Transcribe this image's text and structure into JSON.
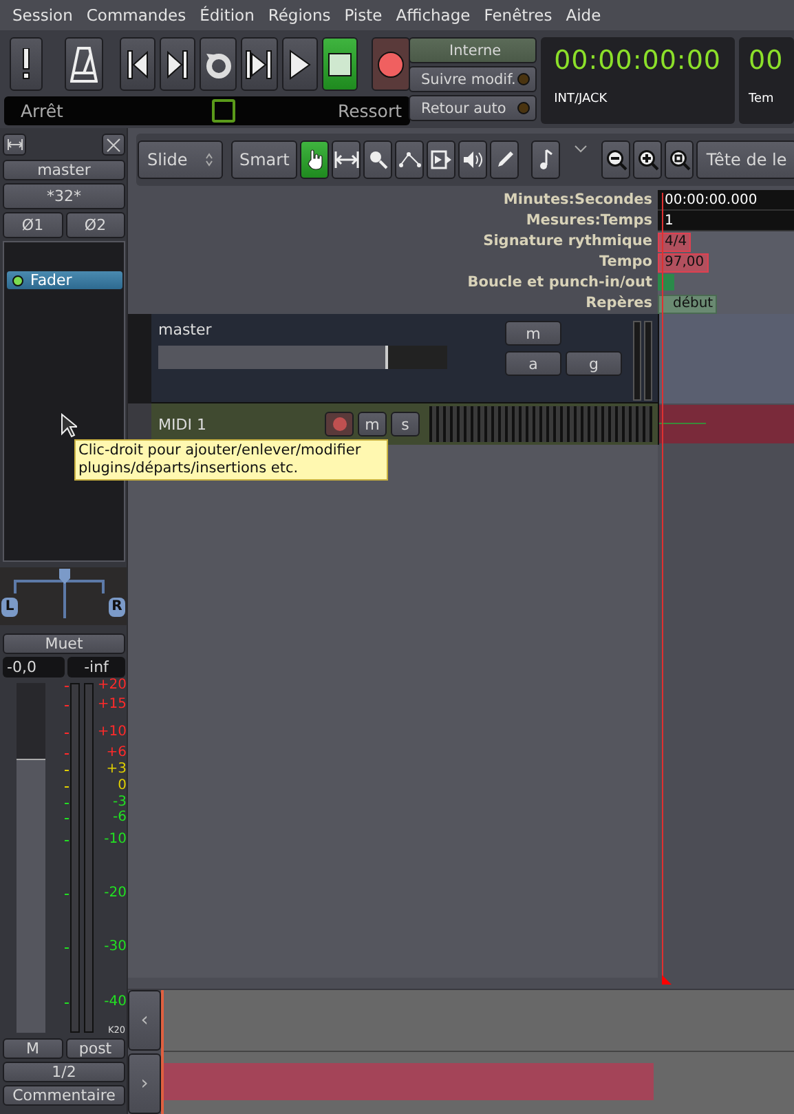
{
  "menu": [
    "Session",
    "Commandes",
    "Édition",
    "Régions",
    "Piste",
    "Affichage",
    "Fenêtres",
    "Aide"
  ],
  "transport": {
    "buttons": [
      {
        "kind": "alert",
        "on": false
      },
      {
        "kind": "metronome",
        "on": false
      },
      {
        "kind": "start",
        "on": false
      },
      {
        "kind": "end",
        "on": false
      },
      {
        "kind": "loop",
        "on": false
      },
      {
        "kind": "range",
        "on": false
      },
      {
        "kind": "play",
        "on": false
      },
      {
        "kind": "stop",
        "on": true
      },
      {
        "kind": "record",
        "on": false
      }
    ],
    "status_left": "Arrêt",
    "status_right": "Ressort",
    "sync_buttons": [
      {
        "label": "Interne",
        "kind": "plain"
      },
      {
        "label": "Suivre modif.",
        "kind": "led",
        "on": false
      },
      {
        "label": "Retour auto",
        "kind": "led",
        "on": false
      }
    ],
    "clocks": [
      {
        "time": "00:00:00:00",
        "source": "INT/JACK"
      },
      {
        "time": "00",
        "source": "Tem"
      }
    ]
  },
  "mixer_strip": {
    "name": "master",
    "input": "*32*",
    "phase": [
      "Ø1",
      "Ø2"
    ],
    "processors": [
      {
        "label": "Fader",
        "on": true
      }
    ],
    "pan_left": "L",
    "pan_right": "R",
    "mute": "Muet",
    "gain": "-0,0",
    "peak": "-inf",
    "fader": {
      "level": 0.78
    },
    "meter_scale": [
      {
        "label": "+20",
        "color": "#ff2a2a"
      },
      {
        "label": "+15",
        "color": "#ff2a2a"
      },
      {
        "label": "+10",
        "color": "#ff2a2a"
      },
      {
        "label": "+6",
        "color": "#ff2a2a"
      },
      {
        "label": "+3",
        "color": "#e0d000"
      },
      {
        "label": "0",
        "color": "#e0d000"
      },
      {
        "label": "-3",
        "color": "#22e022"
      },
      {
        "label": "-6",
        "color": "#22e022"
      },
      {
        "label": "-10",
        "color": "#22e022"
      },
      {
        "label": "-20",
        "color": "#22e022"
      },
      {
        "label": "-30",
        "color": "#22e022"
      },
      {
        "label": "-40",
        "color": "#22e022"
      }
    ],
    "meter_type": "K20",
    "meter_point": "M",
    "meter_pos": "post",
    "output": "1/2",
    "comment": "Commentaire"
  },
  "editor_toolbar": {
    "edit_mode": "Slide",
    "smart": "Smart",
    "tools": [
      {
        "kind": "grab",
        "selected": true
      },
      {
        "kind": "range",
        "selected": false
      },
      {
        "kind": "zoom",
        "selected": false
      },
      {
        "kind": "draw",
        "selected": false
      },
      {
        "kind": "stretch",
        "selected": false
      },
      {
        "kind": "audition",
        "selected": false
      },
      {
        "kind": "pencil",
        "selected": false
      }
    ],
    "zoom_focus": "Tête de le"
  },
  "rulers": [
    {
      "label": "Minutes:Secondes",
      "kind": "clock",
      "value": "00:00:00.000"
    },
    {
      "label": "Mesures:Temps",
      "kind": "clock",
      "value": "1"
    },
    {
      "label": "Signature rythmique",
      "kind": "meter",
      "value": "4/4"
    },
    {
      "label": "Tempo",
      "kind": "tempo",
      "value": "97,00"
    },
    {
      "label": "Boucle et punch-in/out",
      "kind": "loop"
    },
    {
      "label": "Repères",
      "kind": "marker",
      "value": "début"
    }
  ],
  "tracks": [
    {
      "name": "master",
      "kind": "bus",
      "buttons": [
        "m",
        "a",
        "g"
      ]
    },
    {
      "name": "MIDI 1",
      "kind": "midi",
      "buttons": [
        "m",
        "s"
      ]
    }
  ],
  "tooltip": "Clic-droit pour ajouter/enlever/modifier plugins/départs/insertions etc.",
  "summary": {
    "prev": "‹",
    "next": "›"
  }
}
